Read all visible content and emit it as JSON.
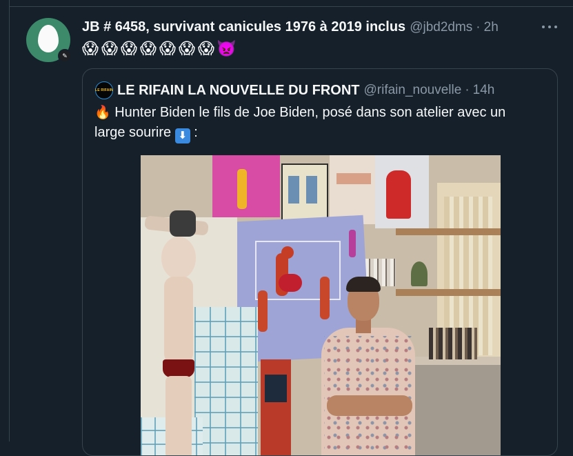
{
  "tweet": {
    "display_name": "JB # 6458, survivant canicules 1976 à 2019 inclus",
    "handle": "@jbd2dms",
    "separator": "·",
    "time": "2h",
    "emojis": [
      "😱",
      "😱",
      "😱",
      "😱",
      "😱",
      "😱",
      "😱",
      "👿"
    ],
    "avatar_icon": "egg-avatar-icon",
    "badge_icon": "feather-badge-icon",
    "more_icon": "more-options-icon"
  },
  "quote": {
    "avatar_text": "LE RIFAIN",
    "display_name": "LE RIFAIN LA NOUVELLE DU FRONT",
    "handle": "@rifain_nouvelle",
    "separator": "·",
    "time": "14h",
    "fire_emoji": "🔥",
    "text_main": "Hunter Biden le fils de Joe Biden, posé dans son atelier avec un large sourire",
    "arrow_emoji": "⬇",
    "text_end": ":",
    "media_icon": "photo-media-icon"
  },
  "colors": {
    "background": "#15202b",
    "border": "#38444d",
    "text_primary": "#f7f9f9",
    "text_secondary": "#8b98a5",
    "avatar_green": "#3d8a6a"
  }
}
